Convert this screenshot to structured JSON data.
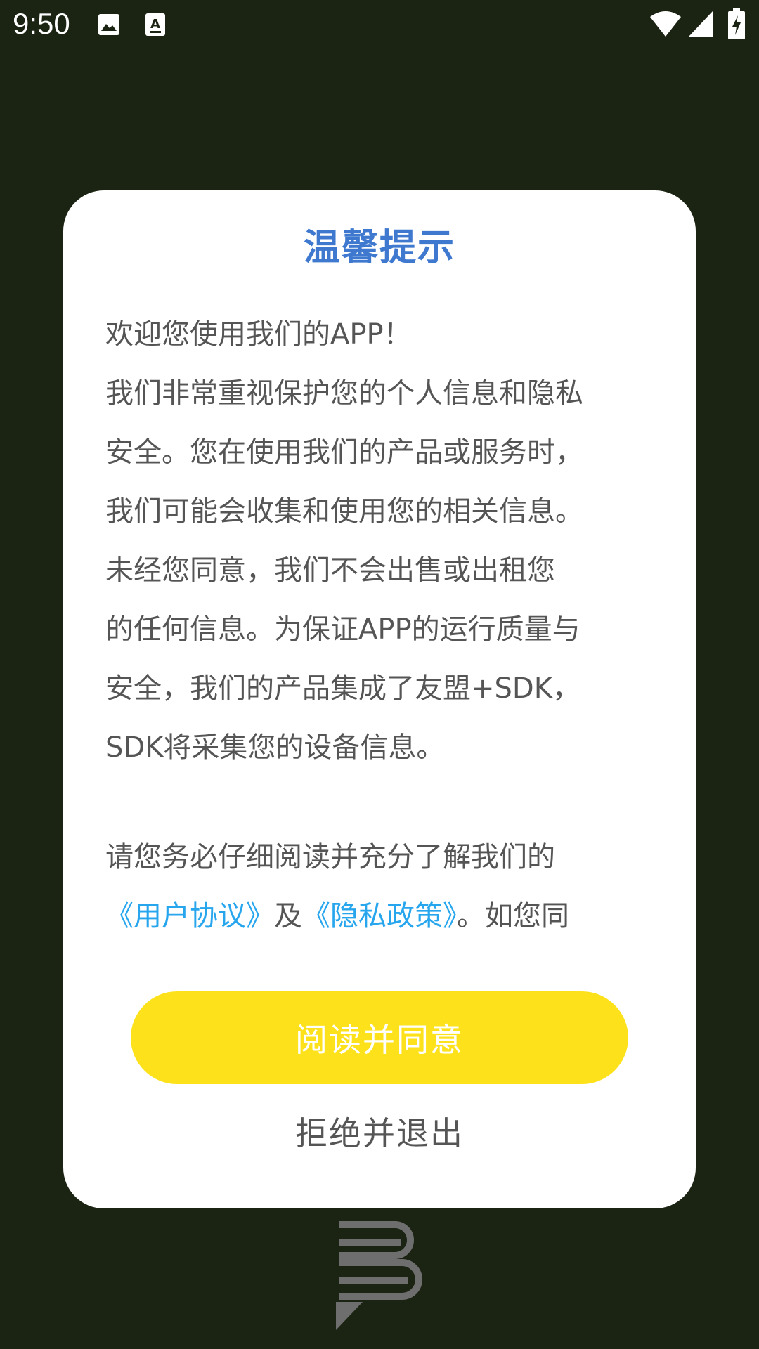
{
  "status_bar": {
    "time": "9:50",
    "icons": [
      "image-icon",
      "text-a-icon",
      "wifi-icon",
      "signal-icon",
      "battery-charging-icon"
    ]
  },
  "dialog": {
    "title": "温馨提示",
    "lines": [
      "欢迎您使用我们的APP！",
      "我们非常重视保护您的个人信息和隐私",
      "安全。您在使用我们的产品或服务时，",
      "我们可能会收集和使用您的相关信息。",
      "未经您同意，我们不会出售或出租您",
      "的任何信息。为保证APP的运行质量与",
      "安全，我们的产品集成了友盟+SDK，",
      "SDK将采集您的设备信息。"
    ],
    "para2_line1": "请您务必仔细阅读并充分了解我们的",
    "user_agreement_link": "《用户协议》",
    "and_text": "及",
    "privacy_policy_link": "《隐私政策》",
    "trailing_text": "。如您同",
    "agree_label": "阅读并同意",
    "reject_label": "拒绝并退出"
  },
  "colors": {
    "background": "#1b2312",
    "title": "#3f79cf",
    "link": "#27a6ee",
    "agree_button": "#fde21b"
  }
}
